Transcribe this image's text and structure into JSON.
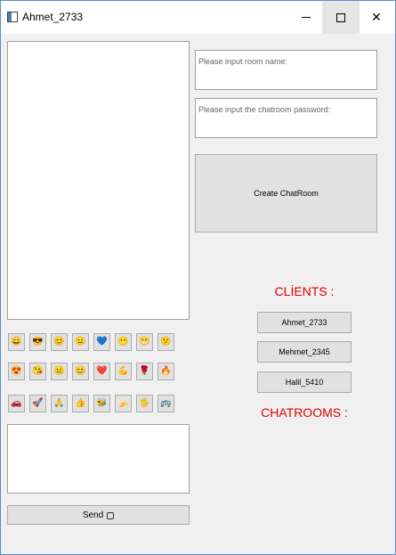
{
  "window": {
    "title": "Ahmet_2733"
  },
  "room": {
    "name_placeholder": "Please input room name:",
    "password_placeholder": "Please input the chatroom password:",
    "create_label": "Create ChatRoom"
  },
  "clients": {
    "heading": "CLİENTS :",
    "items": [
      "Ahmet_2733",
      "Mehmet_2345",
      "Halil_5410"
    ]
  },
  "chatrooms": {
    "heading": "CHATROOMS :"
  },
  "send": {
    "label": "Send"
  },
  "emojis": [
    "😄",
    "😎",
    "😊",
    "😐",
    "💙",
    "😶",
    "😁",
    "😕",
    "😍",
    "😘",
    "😐",
    "😊",
    "❤️",
    "💪",
    "🌹",
    "🔥",
    "🚗",
    "🚀",
    "🙏",
    "👍",
    "🐝",
    "🍌",
    "🖐",
    "🚌"
  ]
}
